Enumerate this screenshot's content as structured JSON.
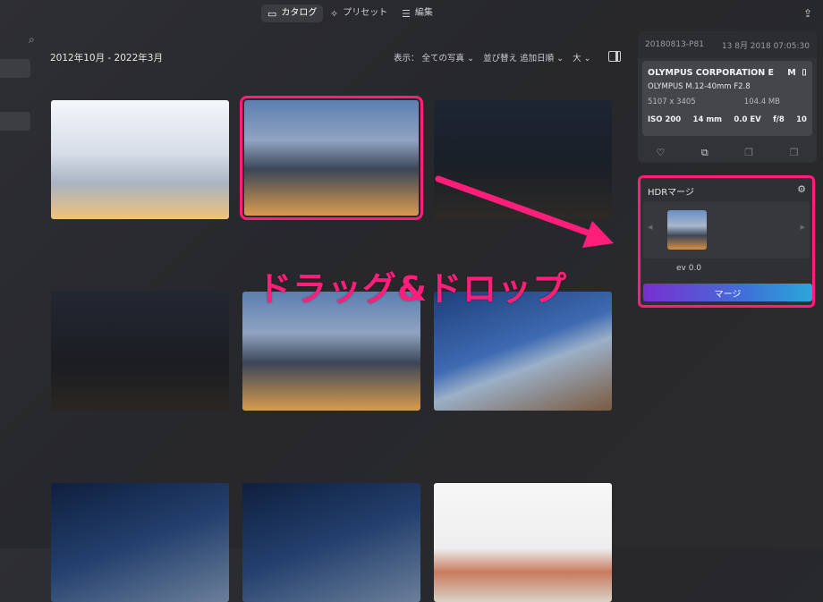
{
  "topbar": {
    "tabs": [
      {
        "label": "カタログ",
        "icon": "folder-icon",
        "active": true
      },
      {
        "label": "プリセット",
        "icon": "magic-wand-icon",
        "active": false
      },
      {
        "label": "編集",
        "icon": "sliders-icon",
        "active": false
      }
    ],
    "share_icon": "share-icon"
  },
  "toolbar": {
    "date_range": "2012年10月 - 2022年3月",
    "view_label": "表示：",
    "view_value": "全ての写真",
    "sort_label": "並び替え",
    "sort_value": "追加日順",
    "size_value": "大"
  },
  "photos": [
    {
      "id": "p1",
      "selected": false
    },
    {
      "id": "p2",
      "selected": true
    },
    {
      "id": "p3",
      "selected": false
    },
    {
      "id": "p4",
      "selected": false
    },
    {
      "id": "p5",
      "selected": false
    },
    {
      "id": "p6",
      "selected": false
    },
    {
      "id": "p7",
      "selected": false
    },
    {
      "id": "p8",
      "selected": false
    },
    {
      "id": "p9",
      "selected": false
    }
  ],
  "info_panel": {
    "filename": "20180813-P81",
    "datetime": "13 8月 2018 07:05:30",
    "camera": "OLYMPUS CORPORATION E",
    "mode": "M",
    "lens": "OLYMPUS M.12-40mm F2.8",
    "dimensions": "5107 x 3405",
    "filesize": "104.4 MB",
    "iso": "ISO 200",
    "focal": "14 mm",
    "ev": "0.0 EV",
    "aperture": "f/8",
    "shutter": "10"
  },
  "hdr_panel": {
    "title": "HDRマージ",
    "ev_label": "ev 0.0",
    "button_label": "マージ"
  },
  "annotation": {
    "text": "ドラッグ&ドロップ",
    "color": "#ff1f7a"
  }
}
